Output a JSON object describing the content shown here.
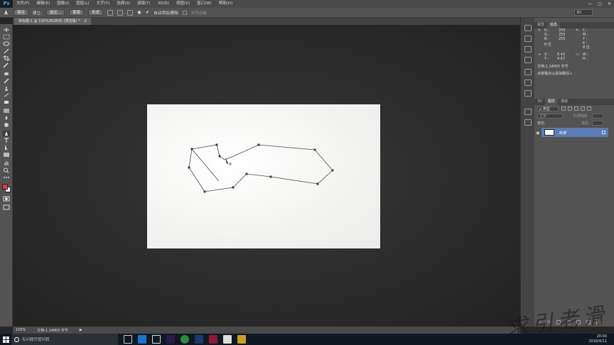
{
  "app": {
    "logo": "Ps"
  },
  "menu": [
    "文件(F)",
    "编辑(E)",
    "图像(I)",
    "图层(L)",
    "文字(Y)",
    "选择(S)",
    "滤镜(T)",
    "3D(D)",
    "视图(V)",
    "窗口(W)",
    "帮助(H)"
  ],
  "window_controls": {
    "minimize": "—",
    "maximize": "▢",
    "close": "✕"
  },
  "options_bar": {
    "mode_value": "路径",
    "make_label": "建立:",
    "selection_button": "选区...",
    "mask_button": "蒙版",
    "shape_button": "形状",
    "auto_add_delete": "自动添加/删除",
    "align_edges": "对齐边缘",
    "workspace": "3D"
  },
  "document_tab": {
    "title": "未标题-1 @ 100%(RGB/8) (预览版) *",
    "close": "×"
  },
  "status_bar": {
    "zoom": "100%",
    "doc_info": "文档:1.14M/0 字节"
  },
  "panels": {
    "top_tabs": [
      "属性",
      "信息"
    ],
    "info": {
      "r_label": "R :",
      "r_value": "255",
      "g_label": "G :",
      "g_value": "255",
      "b_label": "B :",
      "b_value": "255",
      "c_label": "C :",
      "m_label": "M :",
      "y_label": "Y :",
      "k_label": "K :",
      "bit_left": "8 位",
      "bit_right": "8 位",
      "x_label": "X :",
      "x_value": "6.42",
      "y2_label": "Y :",
      "y2_value": "4.67",
      "w_label": "W :",
      "h_label": "H :",
      "doc_size": "文档:1.14M/0 字节",
      "hint": "点按锚点以添加路径+"
    },
    "layer_tabs": [
      "3D",
      "图层",
      "通道"
    ],
    "layer_filter": "ρ 类型",
    "blend_mode": "正常",
    "opacity_label": "不透明度:",
    "lock_label": "锁定:",
    "fill_label": "填充:",
    "layer_name": "背景"
  },
  "taskbar": {
    "search_placeholder": "有问题尽管问我",
    "time": "20:00",
    "date": "2016/4/11"
  },
  "watermark": "求引老滑",
  "colors": {
    "foreground": "#e03a3a",
    "background": "#ffffff",
    "selected_layer": "#5b7bb3",
    "ps_blue": "#31a8ff"
  }
}
